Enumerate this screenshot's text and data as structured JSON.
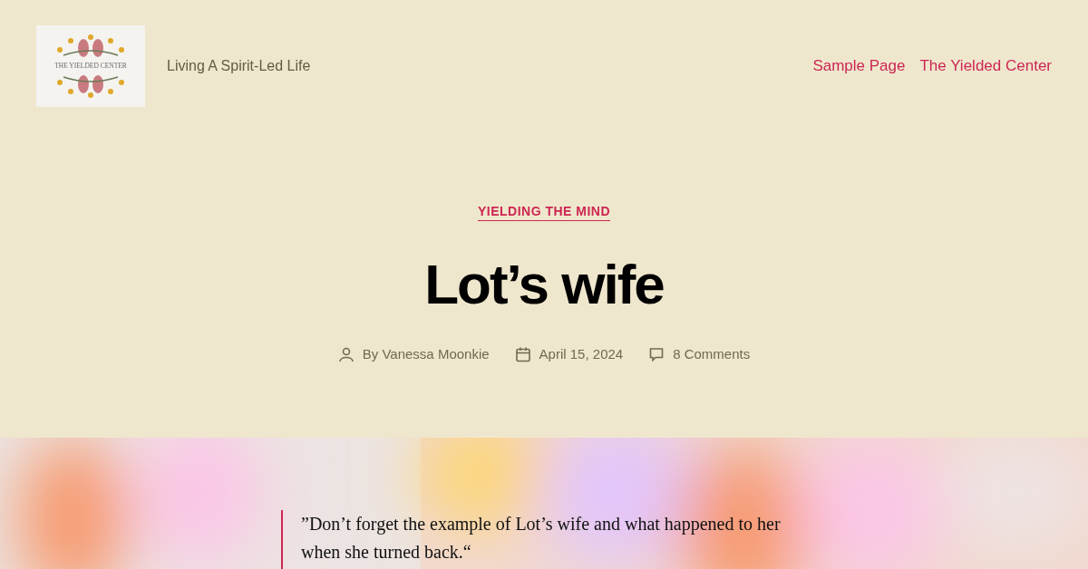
{
  "header": {
    "logo_text": "THE YIELDED CENTER",
    "tagline": "Living A Spirit-Led Life",
    "nav": [
      "Sample Page",
      "The Yielded Center"
    ]
  },
  "post": {
    "category": "YIELDING THE MIND",
    "title": "Lot’s wife",
    "meta": [
      {
        "kind": "author",
        "text": "By Vanessa Moonkie"
      },
      {
        "kind": "date",
        "text": "April 15, 2024"
      },
      {
        "kind": "comments",
        "text": "8 Comments"
      }
    ]
  },
  "featured": {
    "kind": "picture",
    "quote": "”Don’t forget the example of Lot’s wife and what happened to her when she turned back.“"
  }
}
